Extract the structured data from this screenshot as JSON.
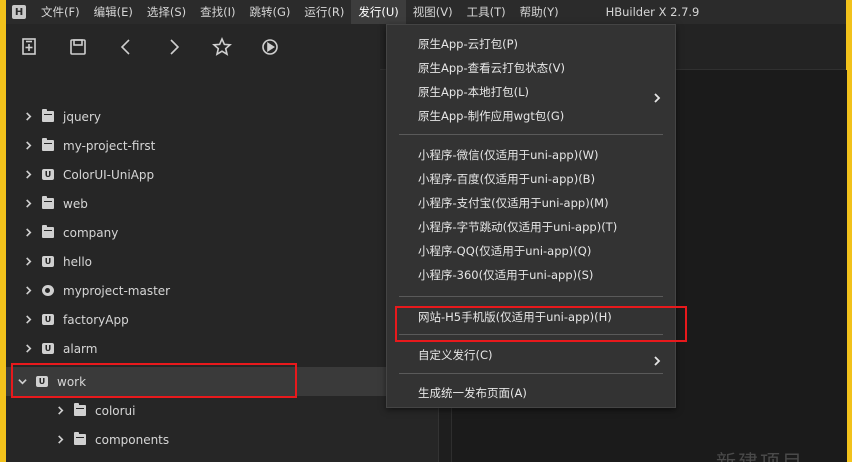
{
  "menubar": {
    "logo": "H",
    "items": [
      {
        "label": "文件(F)"
      },
      {
        "label": "编辑(E)"
      },
      {
        "label": "选择(S)"
      },
      {
        "label": "查找(I)"
      },
      {
        "label": "跳转(G)"
      },
      {
        "label": "运行(R)"
      },
      {
        "label": "发行(U)"
      },
      {
        "label": "视图(V)"
      },
      {
        "label": "工具(T)"
      },
      {
        "label": "帮助(Y)"
      }
    ],
    "active_item": "发行(U)",
    "app_title": "HBuilder X 2.7.9"
  },
  "toolbar": {
    "icons": [
      "new-file-icon",
      "save-icon",
      "back-icon",
      "forward-icon",
      "favorite-star-icon",
      "run-icon"
    ]
  },
  "sidebar": {
    "items": [
      {
        "label": "jquery",
        "icon": "folder-icon",
        "expanded": false
      },
      {
        "label": "my-project-first",
        "icon": "folder-icon",
        "expanded": false
      },
      {
        "label": "ColorUI-UniApp",
        "icon": "uniapp-project-icon",
        "expanded": false
      },
      {
        "label": "web",
        "icon": "folder-icon",
        "expanded": false
      },
      {
        "label": "company",
        "icon": "folder-icon",
        "expanded": false
      },
      {
        "label": "hello",
        "icon": "uniapp-project-icon",
        "expanded": false
      },
      {
        "label": "myproject-master",
        "icon": "circle-project-icon",
        "expanded": false
      },
      {
        "label": "factoryApp",
        "icon": "uniapp-project-icon",
        "expanded": false
      },
      {
        "label": "alarm",
        "icon": "uniapp-project-icon",
        "expanded": false
      },
      {
        "label": "work",
        "icon": "uniapp-project-icon",
        "expanded": true,
        "selected": true
      },
      {
        "label": "colorui",
        "icon": "folder-icon",
        "expanded": false,
        "child": true
      },
      {
        "label": "components",
        "icon": "folder-icon",
        "expanded": false,
        "child": true
      }
    ]
  },
  "dropdown": {
    "group1": [
      {
        "label": "原生App-云打包(P)"
      },
      {
        "label": "原生App-查看云打包状态(V)"
      },
      {
        "label": "原生App-本地打包(L)",
        "submenu": true
      },
      {
        "label": "原生App-制作应用wgt包(G)"
      }
    ],
    "group2": [
      {
        "label": "小程序-微信(仅适用于uni-app)(W)"
      },
      {
        "label": "小程序-百度(仅适用于uni-app)(B)"
      },
      {
        "label": "小程序-支付宝(仅适用于uni-app)(M)"
      },
      {
        "label": "小程序-字节跳动(仅适用于uni-app)(T)"
      },
      {
        "label": "小程序-QQ(仅适用于uni-app)(Q)"
      },
      {
        "label": "小程序-360(仅适用于uni-app)(S)"
      }
    ],
    "h5_item": {
      "label": "网站-H5手机版(仅适用于uni-app)(H)"
    },
    "custom_item": {
      "label": "自定义发行(C)",
      "submenu": true
    },
    "publish_page_item": {
      "label": "生成统一发布页面(A)"
    }
  },
  "editor": {
    "ghost_text": "新建项目"
  },
  "colors": {
    "accent_frame": "#f2c21b",
    "highlight_box": "#e8191c",
    "menu_bg": "#333333"
  }
}
